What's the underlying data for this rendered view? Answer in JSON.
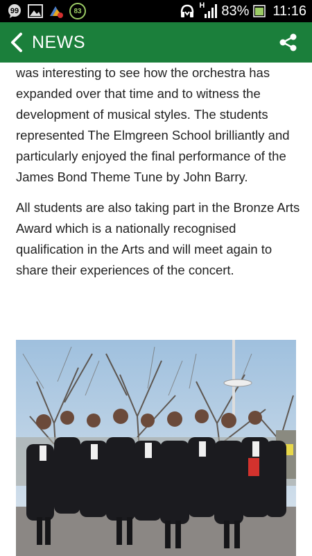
{
  "status_bar": {
    "notification_badge": "83",
    "network_type": "H",
    "battery_percent": "83%",
    "time": "11:16",
    "icons": [
      "chat-bubble-icon",
      "image-icon",
      "app-update-icon",
      "notification-count-icon",
      "headset-icon",
      "signal-icon",
      "battery-icon"
    ]
  },
  "app_bar": {
    "title": "NEWS",
    "background_color": "#1b7f3b",
    "icons": [
      "back-arrow-icon",
      "share-icon"
    ]
  },
  "article": {
    "paragraphs": [
      "was interesting to see how the orchestra has expanded over that time and to witness the development of musical styles. The students represented The Elmgreen School brilliantly and particularly enjoyed the final performance of the James Bond Theme Tune by John Barry.",
      "All students are also taking part in the Bronze Arts Award which is a nationally recognised qualification in the Arts and will meet again to share their experiences of the concert."
    ]
  }
}
